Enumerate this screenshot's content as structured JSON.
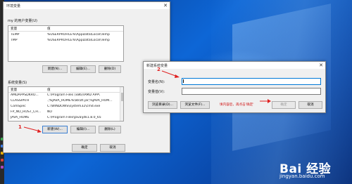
{
  "env_window": {
    "title": "环境变量",
    "user_section_label": "my 的用户变量(U)",
    "user_columns": [
      "变量",
      "值"
    ],
    "user_vars": [
      {
        "name": "TEMP",
        "value": "%USERPROFILE%\\AppData\\Local\\Temp"
      },
      {
        "name": "TMP",
        "value": "%USERPROFILE%\\AppData\\Local\\Temp"
      }
    ],
    "user_buttons": {
      "new": "新建(N)...",
      "edit": "编辑(E)...",
      "delete": "删除(D)"
    },
    "sys_section_label": "系统变量(S)",
    "sys_columns": [
      "变量",
      "值"
    ],
    "sys_vars": [
      {
        "name": "AMDAPPSDKRO...",
        "value": "C:\\Program Files (x86)\\AMD APP\\"
      },
      {
        "name": "CLASSPATH",
        "value": ".;%JAVA_HOME%\\lib\\dt.jar;%JAVA_HOM..."
      },
      {
        "name": "ComSpec",
        "value": "C:\\WINDOWS\\system32\\cmd.exe"
      },
      {
        "name": "FP_NO_HOST_CH...",
        "value": "NO"
      },
      {
        "name": "JAVA_HOME",
        "value": "C:\\Program Files\\Java\\jdk1.8.0_65"
      }
    ],
    "sys_buttons": {
      "new": "新建(W)...",
      "edit": "编辑(I)...",
      "delete": "删除(L)"
    },
    "ok": "确定",
    "cancel": "取消"
  },
  "new_var_dialog": {
    "title": "新建系统变量",
    "name_label": "变量名(N):",
    "name_value": "",
    "value_label": "变量值(V):",
    "value_value": "",
    "browse_dir": "浏览目录(D)...",
    "browse_file": "浏览文件(F)...",
    "hint": "填内容后，再点击'确定'",
    "ok": "确定",
    "cancel": "取消"
  },
  "annotations": {
    "step1": "1",
    "step2": "2"
  },
  "watermark": {
    "brand": "Bai 经验",
    "url": "jingyan.baidu.com"
  },
  "colors": {
    "annotation": "#e02020",
    "desktop": "#0d66d6",
    "focus": "#0078d7"
  }
}
